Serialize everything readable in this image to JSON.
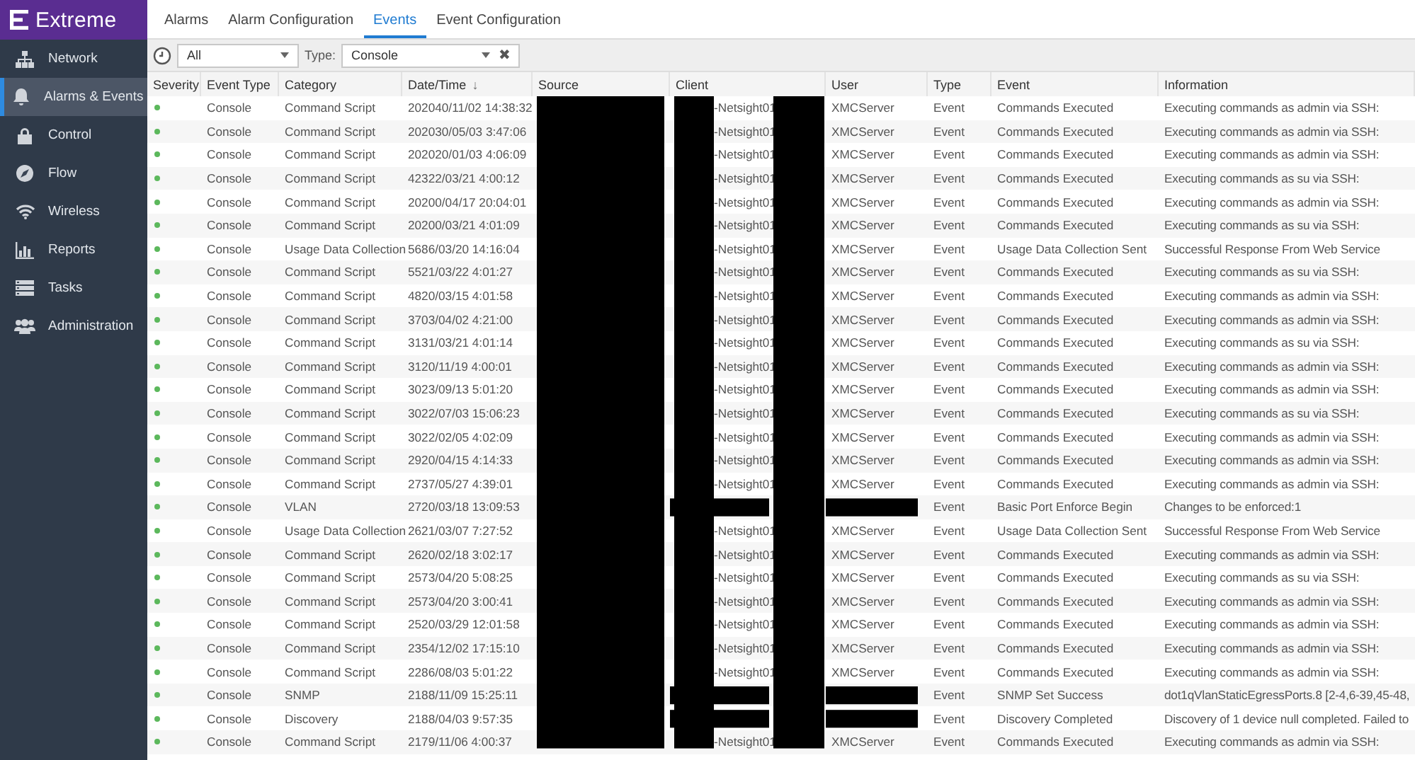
{
  "brand": {
    "name": "Extreme"
  },
  "sidebar": {
    "items": [
      {
        "label": "Network",
        "selected": false
      },
      {
        "label": "Alarms & Events",
        "selected": true
      },
      {
        "label": "Control",
        "selected": false
      },
      {
        "label": "Flow",
        "selected": false
      },
      {
        "label": "Wireless",
        "selected": false
      },
      {
        "label": "Reports",
        "selected": false
      },
      {
        "label": "Tasks",
        "selected": false
      },
      {
        "label": "Administration",
        "selected": false
      }
    ]
  },
  "tabs": [
    {
      "label": "Alarms",
      "selected": false
    },
    {
      "label": "Alarm Configuration",
      "selected": false
    },
    {
      "label": "Events",
      "selected": true
    },
    {
      "label": "Event Configuration",
      "selected": false
    }
  ],
  "filter": {
    "range": "All",
    "type_label": "Type:",
    "type_value": "Console",
    "clear": "✖"
  },
  "table": {
    "columns": [
      {
        "label": "Severity"
      },
      {
        "label": "Event Type"
      },
      {
        "label": "Category"
      },
      {
        "label": "Date/Time",
        "sort_mark": "↓"
      },
      {
        "label": "Source"
      },
      {
        "label": "Client"
      },
      {
        "label": "User"
      },
      {
        "label": "Type"
      },
      {
        "label": "Event"
      },
      {
        "label": "Information"
      }
    ],
    "rows": [
      {
        "color": "#5cb85c",
        "event_type": "Console",
        "category": "Command Script",
        "datetime": "202040/11/02 14:38:32",
        "client": "-Netsight01",
        "user": "XMCServer",
        "type": "Event",
        "event": "Commands Executed",
        "information": "Executing commands as admin via SSH:"
      },
      {
        "color": "#5cb85c",
        "event_type": "Console",
        "category": "Command Script",
        "datetime": "202030/05/03 3:47:06",
        "client": "-Netsight01",
        "user": "XMCServer",
        "type": "Event",
        "event": "Commands Executed",
        "information": "Executing commands as admin via SSH:"
      },
      {
        "color": "#5cb85c",
        "event_type": "Console",
        "category": "Command Script",
        "datetime": "202020/01/03 4:06:09",
        "client": "-Netsight01",
        "user": "XMCServer",
        "type": "Event",
        "event": "Commands Executed",
        "information": "Executing commands as admin via SSH:"
      },
      {
        "color": "#5cb85c",
        "event_type": "Console",
        "category": "Command Script",
        "datetime": "42322/03/21 4:00:12",
        "client": "-Netsight01",
        "user": "XMCServer",
        "type": "Event",
        "event": "Commands Executed",
        "information": "Executing commands as su via SSH:"
      },
      {
        "color": "#5cb85c",
        "event_type": "Console",
        "category": "Command Script",
        "datetime": "20200/04/17 20:04:01",
        "client": "-Netsight01",
        "user": "XMCServer",
        "type": "Event",
        "event": "Commands Executed",
        "information": "Executing commands as admin via SSH:"
      },
      {
        "color": "#5cb85c",
        "event_type": "Console",
        "category": "Command Script",
        "datetime": "20200/03/21 4:01:09",
        "client": "-Netsight01",
        "user": "XMCServer",
        "type": "Event",
        "event": "Commands Executed",
        "information": "Executing commands as su via SSH:"
      },
      {
        "color": "#5cb85c",
        "event_type": "Console",
        "category": "Usage Data Collection",
        "datetime": "5686/03/20 14:16:04",
        "client": "-Netsight01",
        "user": "XMCServer",
        "type": "Event",
        "event": "Usage Data Collection Sent",
        "information": "Successful Response From Web Service"
      },
      {
        "color": "#5cb85c",
        "event_type": "Console",
        "category": "Command Script",
        "datetime": "5521/03/22 4:01:27",
        "client": "-Netsight01",
        "user": "XMCServer",
        "type": "Event",
        "event": "Commands Executed",
        "information": "Executing commands as su via SSH:"
      },
      {
        "color": "#5cb85c",
        "event_type": "Console",
        "category": "Command Script",
        "datetime": "4820/03/15 4:01:58",
        "client": "-Netsight01",
        "user": "XMCServer",
        "type": "Event",
        "event": "Commands Executed",
        "information": "Executing commands as admin via SSH:"
      },
      {
        "color": "#5cb85c",
        "event_type": "Console",
        "category": "Command Script",
        "datetime": "3703/04/02 4:21:00",
        "client": "-Netsight01",
        "user": "XMCServer",
        "type": "Event",
        "event": "Commands Executed",
        "information": "Executing commands as admin via SSH:"
      },
      {
        "color": "#5cb85c",
        "event_type": "Console",
        "category": "Command Script",
        "datetime": "3131/03/21 4:01:14",
        "client": "-Netsight01",
        "user": "XMCServer",
        "type": "Event",
        "event": "Commands Executed",
        "information": "Executing commands as su via SSH:"
      },
      {
        "color": "#5cb85c",
        "event_type": "Console",
        "category": "Command Script",
        "datetime": "3120/11/19 4:00:01",
        "client": "-Netsight01",
        "user": "XMCServer",
        "type": "Event",
        "event": "Commands Executed",
        "information": "Executing commands as admin via SSH:"
      },
      {
        "color": "#5cb85c",
        "event_type": "Console",
        "category": "Command Script",
        "datetime": "3023/09/13 5:01:20",
        "client": "-Netsight01",
        "user": "XMCServer",
        "type": "Event",
        "event": "Commands Executed",
        "information": "Executing commands as admin via SSH:"
      },
      {
        "color": "#5cb85c",
        "event_type": "Console",
        "category": "Command Script",
        "datetime": "3022/07/03 15:06:23",
        "client": "-Netsight01",
        "user": "XMCServer",
        "type": "Event",
        "event": "Commands Executed",
        "information": "Executing commands as su via SSH:"
      },
      {
        "color": "#5cb85c",
        "event_type": "Console",
        "category": "Command Script",
        "datetime": "3022/02/05 4:02:09",
        "client": "-Netsight01",
        "user": "XMCServer",
        "type": "Event",
        "event": "Commands Executed",
        "information": "Executing commands as admin via SSH:"
      },
      {
        "color": "#5cb85c",
        "event_type": "Console",
        "category": "Command Script",
        "datetime": "2920/04/15 4:14:33",
        "client": "-Netsight01",
        "user": "XMCServer",
        "type": "Event",
        "event": "Commands Executed",
        "information": "Executing commands as admin via SSH:"
      },
      {
        "color": "#5cb85c",
        "event_type": "Console",
        "category": "Command Script",
        "datetime": "2737/05/27 4:39:01",
        "client": "-Netsight01",
        "user": "XMCServer",
        "type": "Event",
        "event": "Commands Executed",
        "information": "Executing commands as admin via SSH:"
      },
      {
        "color": "#5cb85c",
        "event_type": "Console",
        "category": "VLAN",
        "datetime": "2720/03/18 13:09:53",
        "type": "Event",
        "event": "Basic Port Enforce Begin",
        "information": "Changes to be enforced:1"
      },
      {
        "color": "#5cb85c",
        "event_type": "Console",
        "category": "Usage Data Collection",
        "datetime": "2621/03/07 7:27:52",
        "client": "-Netsight01",
        "user": "XMCServer",
        "type": "Event",
        "event": "Usage Data Collection Sent",
        "information": "Successful Response From Web Service"
      },
      {
        "color": "#5cb85c",
        "event_type": "Console",
        "category": "Command Script",
        "datetime": "2620/02/18 3:02:17",
        "client": "-Netsight01",
        "user": "XMCServer",
        "type": "Event",
        "event": "Commands Executed",
        "information": "Executing commands as admin via SSH:"
      },
      {
        "color": "#5cb85c",
        "event_type": "Console",
        "category": "Command Script",
        "datetime": "2573/04/20 5:08:25",
        "client": "-Netsight01",
        "user": "XMCServer",
        "type": "Event",
        "event": "Commands Executed",
        "information": "Executing commands as su via SSH:"
      },
      {
        "color": "#5cb85c",
        "event_type": "Console",
        "category": "Command Script",
        "datetime": "2573/04/20 3:00:41",
        "client": "-Netsight01",
        "user": "XMCServer",
        "type": "Event",
        "event": "Commands Executed",
        "information": "Executing commands as admin via SSH:"
      },
      {
        "color": "#5cb85c",
        "event_type": "Console",
        "category": "Command Script",
        "datetime": "2520/03/29 12:01:58",
        "client": "-Netsight01",
        "user": "XMCServer",
        "type": "Event",
        "event": "Commands Executed",
        "information": "Executing commands as admin via SSH:"
      },
      {
        "color": "#5cb85c",
        "event_type": "Console",
        "category": "Command Script",
        "datetime": "2354/12/02 17:15:10",
        "client": "-Netsight01",
        "user": "XMCServer",
        "type": "Event",
        "event": "Commands Executed",
        "information": "Executing commands as admin via SSH:"
      },
      {
        "color": "#5cb85c",
        "event_type": "Console",
        "category": "Command Script",
        "datetime": "2286/08/03 5:01:22",
        "client": "-Netsight01",
        "user": "XMCServer",
        "type": "Event",
        "event": "Commands Executed",
        "information": "Executing commands as admin via SSH:"
      },
      {
        "color": "#5cb85c",
        "event_type": "Console",
        "category": "SNMP",
        "datetime": "2188/11/09 15:25:11",
        "type": "Event",
        "event": "SNMP Set Success",
        "information": "dot1qVlanStaticEgressPorts.8 [2-4,6-39,45-48,"
      },
      {
        "color": "#5cb85c",
        "event_type": "Console",
        "category": "Discovery",
        "datetime": "2188/04/03 9:57:35",
        "type": "Event",
        "event": "Discovery Completed",
        "information": "Discovery of 1 device null completed. Failed to"
      },
      {
        "color": "#5cb85c",
        "event_type": "Console",
        "category": "Command Script",
        "datetime": "2179/11/06 4:00:37",
        "client": "-Netsight01",
        "user": "XMCServer",
        "type": "Event",
        "event": "Commands Executed",
        "information": "Executing commands as admin via SSH:"
      }
    ]
  }
}
